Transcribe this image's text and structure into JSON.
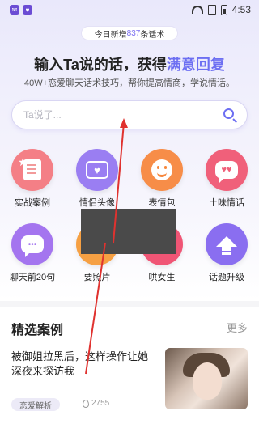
{
  "status_bar": {
    "time": "4:53"
  },
  "banner": {
    "prefix": "今日新增",
    "count": "837",
    "suffix": "条话术"
  },
  "hero": {
    "title_main": "输入Ta说的话，获得",
    "title_accent": "满意回复",
    "subtitle": "40W+恋爱聊天话术技巧，帮你提高情商，学说情话。"
  },
  "search": {
    "placeholder": "Ta说了..."
  },
  "grid": {
    "items": [
      {
        "label": "实战案例",
        "icon": "document-star-icon",
        "color": "#f47f86"
      },
      {
        "label": "情侣头像",
        "icon": "heart-image-icon",
        "color": "#9a7ef2"
      },
      {
        "label": "表情包",
        "icon": "smiley-icon",
        "color": "#f78d48"
      },
      {
        "label": "土味情话",
        "icon": "heart-bubble-icon",
        "color": "#f0607a"
      },
      {
        "label": "聊天前20句",
        "icon": "chat-bubble-icon",
        "color": "#a475ef"
      },
      {
        "label": "要照片",
        "icon": "photo-icon",
        "color": "#f6a043"
      },
      {
        "label": "哄女生",
        "icon": "heart-icon",
        "color": "#f05575"
      },
      {
        "label": "话题升级",
        "icon": "arrow-up-icon",
        "color": "#8a6ef0"
      }
    ]
  },
  "featured": {
    "title": "精选案例",
    "more": "更多",
    "case": {
      "title": "被御姐拉黑后，这样操作让她深夜来探访我",
      "tag": "恋爱解析",
      "views": "2755"
    }
  },
  "accent_color": "#6d6ff2"
}
